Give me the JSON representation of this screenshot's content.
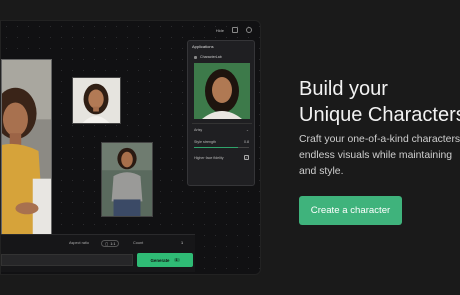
{
  "topbar": {
    "label": "Hide"
  },
  "panel": {
    "title": "Applications",
    "app_name": "CharacterLab",
    "row_mode": "Artsy",
    "row_strength_label": "Style strength",
    "row_strength_value": "0.8",
    "strength_fraction": 0.8,
    "row_face_label": "Higher face fidelity",
    "face_checked": "✓"
  },
  "bottombar": {
    "aspect_label": "Aspect ratio",
    "aspect_value": "1:1",
    "count_label": "Count",
    "count_value": "1",
    "generate_label": "Generate",
    "generate_cost": "1"
  },
  "hero": {
    "headline_line1": "Build your",
    "headline_line2": "Unique Characters",
    "desc_line1": "Craft your one-of-a-kind characters,",
    "desc_line2": "endless visuals while maintaining",
    "desc_line3": "and style.",
    "cta_label": "Create a character"
  },
  "colors": {
    "accent": "#3fb37c",
    "generate": "#2fbb75",
    "background": "#1a1a1a"
  }
}
